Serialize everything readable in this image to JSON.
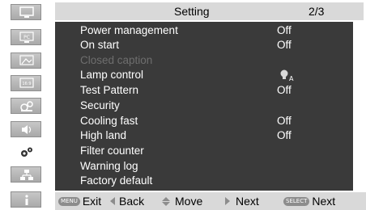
{
  "header": {
    "title": "Setting",
    "page": "2/3"
  },
  "menu": [
    {
      "label": "Power management",
      "value": "Off",
      "disabled": false
    },
    {
      "label": "On start",
      "value": "Off",
      "disabled": false
    },
    {
      "label": "Closed caption",
      "value": "",
      "disabled": true
    },
    {
      "label": "Lamp control",
      "value": "",
      "icon": "lamp-auto-icon",
      "icon_text": "A",
      "disabled": false
    },
    {
      "label": "Test Pattern",
      "value": "Off",
      "disabled": false
    },
    {
      "label": "Security",
      "value": "",
      "disabled": false
    },
    {
      "label": "Cooling fast",
      "value": "Off",
      "disabled": false
    },
    {
      "label": "High land",
      "value": "Off",
      "disabled": false
    },
    {
      "label": "Filter counter",
      "value": "",
      "disabled": false
    },
    {
      "label": "Warning log",
      "value": "",
      "disabled": false
    },
    {
      "label": "Factory default",
      "value": "",
      "disabled": false
    }
  ],
  "sidebar": [
    {
      "icon": "display-icon",
      "active": false
    },
    {
      "icon": "pc-adjust-icon",
      "active": false
    },
    {
      "icon": "image-select-icon",
      "active": false
    },
    {
      "icon": "screen-icon",
      "active": false
    },
    {
      "icon": "setting-icon",
      "active": false
    },
    {
      "icon": "sound-icon",
      "active": false
    },
    {
      "icon": "gear-icon",
      "active": true
    },
    {
      "icon": "network-icon",
      "active": false
    },
    {
      "icon": "info-icon",
      "active": false
    }
  ],
  "footer": {
    "menu_btn": "MENU",
    "exit": "Exit",
    "back": "Back",
    "move": "Move",
    "next": "Next",
    "select_btn": "SELECT",
    "select_next": "Next"
  },
  "colors": {
    "panel": "#3a3a3a",
    "header": "#d9d9d9",
    "text": "#ffffff",
    "disabled": "#6e6e6e"
  }
}
